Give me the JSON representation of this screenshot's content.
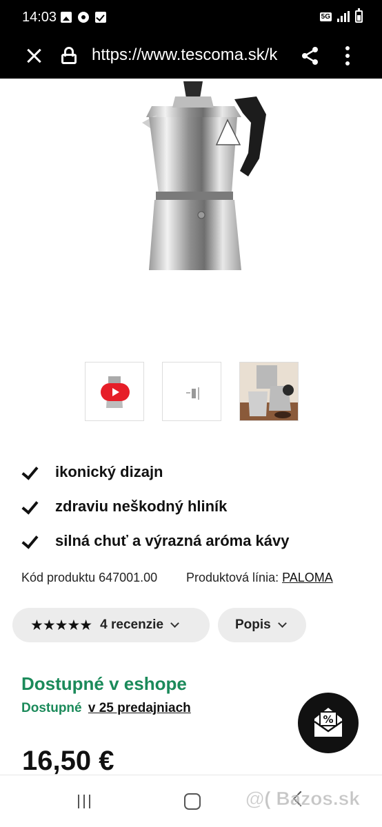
{
  "status_bar": {
    "time": "14:03",
    "left_icons": [
      "gallery-icon",
      "chrome-icon",
      "checkbox-icon"
    ],
    "network": "5G"
  },
  "browser": {
    "url": "https://www.tescoma.sk/k"
  },
  "product": {
    "thumbnails": [
      "video-thumbnail",
      "dimensions-thumbnail",
      "lifestyle-thumbnail"
    ],
    "features": [
      "ikonický dizajn",
      "zdraviu neškodný hliník",
      "silná chuť a výrazná aróma kávy"
    ],
    "code_label": "Kód produktu 647001.00",
    "line_label": "Produktová línia:",
    "line_value": "PALOMA",
    "reviews": {
      "stars": "★★★★★",
      "rating": 4.5,
      "label": "4 recenzie"
    },
    "description_label": "Popis",
    "availability_title": "Dostupné v eshope",
    "availability_status": "Dostupné",
    "availability_stores": "v 25 predajniach",
    "price": "16,50 €"
  },
  "watermark": "@( Bazos.sk",
  "colors": {
    "accent_green": "#1b8a5a",
    "status_bar": "#000000",
    "pill_bg": "#ececec"
  }
}
